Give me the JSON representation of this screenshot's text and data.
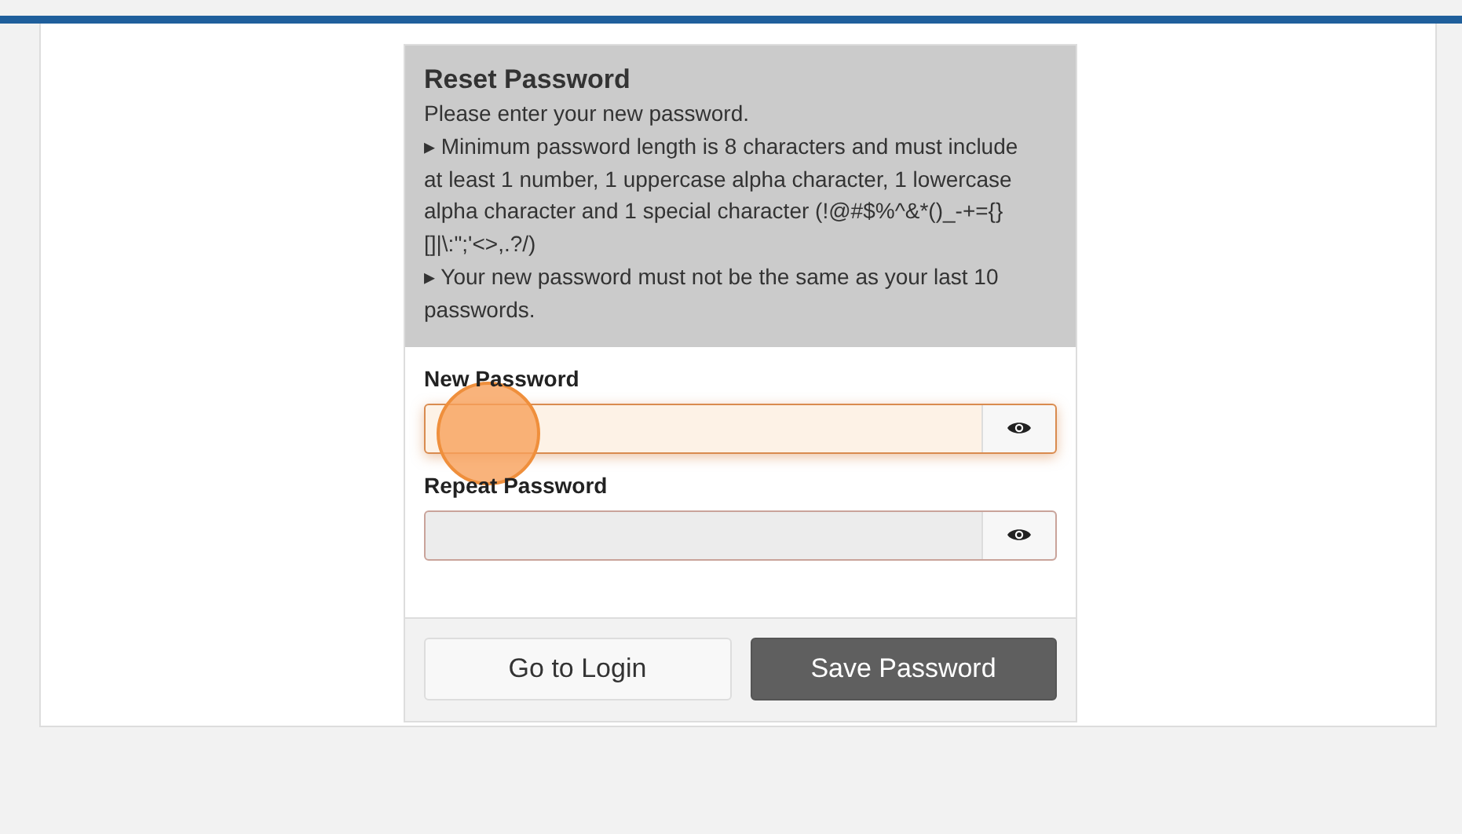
{
  "card": {
    "title": "Reset Password",
    "intro": "Please enter your new password.",
    "rules": [
      "▸ Minimum password length is 8 characters and must include at least 1 number, 1 uppercase alpha character, 1 lowercase alpha character and 1 special character (!@#$%^&*()_-+={}[]|\\:\";'<>,.?/)",
      "▸ Your new password must not be the same as your last 10 passwords."
    ]
  },
  "fields": [
    {
      "label": "New Password",
      "focused": true
    },
    {
      "label": "Repeat Password",
      "focused": false
    }
  ],
  "buttons": [
    {
      "label": "Go to Login",
      "kind": "secondary"
    },
    {
      "label": "Save Password",
      "kind": "primary"
    }
  ],
  "click_marker": {
    "kind": "circle"
  }
}
